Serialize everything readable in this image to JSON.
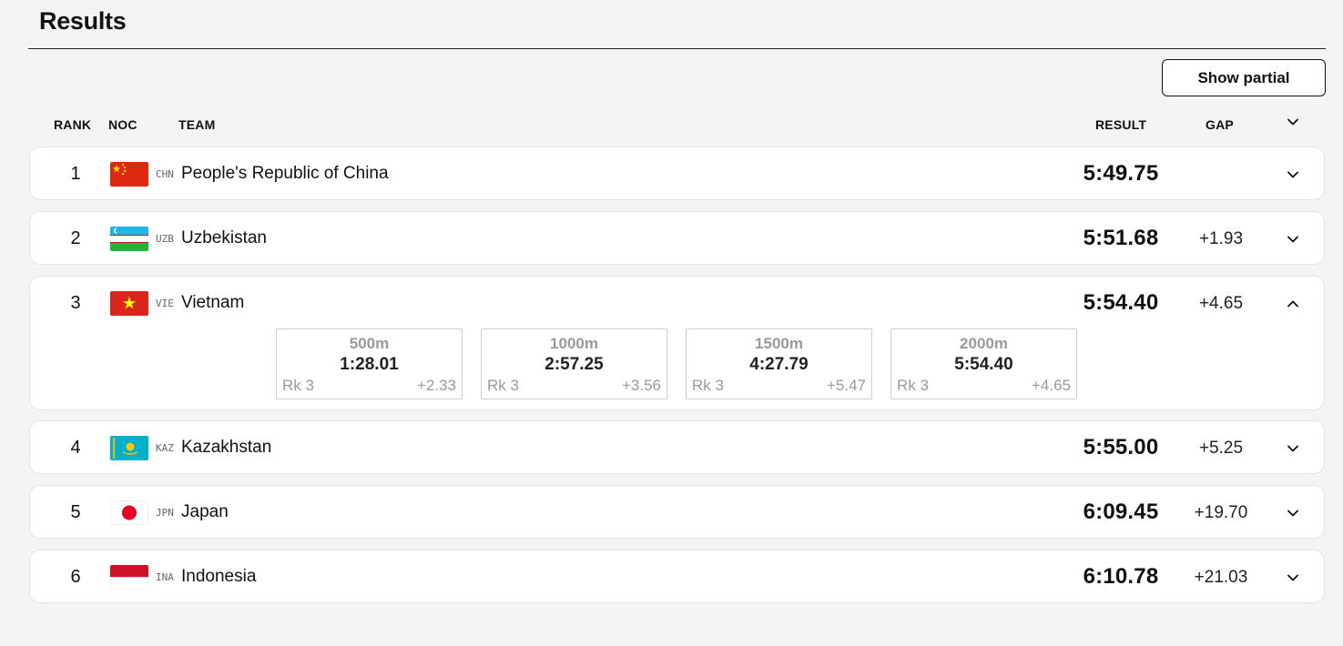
{
  "page": {
    "title": "Results"
  },
  "toolbar": {
    "show_partial_label": "Show partial"
  },
  "header": {
    "rank": "RANK",
    "noc": "NOC",
    "team": "TEAM",
    "result": "RESULT",
    "gap": "GAP"
  },
  "rows": [
    {
      "rank": "1",
      "noc": "CHN",
      "team": "People's Republic of China",
      "result": "5:49.75",
      "gap": "",
      "flag": "china-flag-icon"
    },
    {
      "rank": "2",
      "noc": "UZB",
      "team": "Uzbekistan",
      "result": "5:51.68",
      "gap": "+1.93",
      "flag": "uzbekistan-flag-icon"
    },
    {
      "rank": "3",
      "noc": "VIE",
      "team": "Vietnam",
      "result": "5:54.40",
      "gap": "+4.65",
      "flag": "vietnam-flag-icon",
      "expanded": true,
      "splits": [
        {
          "distance": "500m",
          "time": "1:28.01",
          "rank": "Rk 3",
          "gap": "+2.33"
        },
        {
          "distance": "1000m",
          "time": "2:57.25",
          "rank": "Rk 3",
          "gap": "+3.56"
        },
        {
          "distance": "1500m",
          "time": "4:27.79",
          "rank": "Rk 3",
          "gap": "+5.47"
        },
        {
          "distance": "2000m",
          "time": "5:54.40",
          "rank": "Rk 3",
          "gap": "+4.65"
        }
      ]
    },
    {
      "rank": "4",
      "noc": "KAZ",
      "team": "Kazakhstan",
      "result": "5:55.00",
      "gap": "+5.25",
      "flag": "kazakhstan-flag-icon"
    },
    {
      "rank": "5",
      "noc": "JPN",
      "team": "Japan",
      "result": "6:09.45",
      "gap": "+19.70",
      "flag": "japan-flag-icon"
    },
    {
      "rank": "6",
      "noc": "INA",
      "team": "Indonesia",
      "result": "6:10.78",
      "gap": "+21.03",
      "flag": "indonesia-flag-icon"
    }
  ],
  "colors": {
    "background": "#f4f4f4",
    "card": "#ffffff",
    "text": "#111111",
    "muted": "#9a9a9a"
  },
  "icons": {
    "expand": "chevron-down-icon",
    "collapse": "chevron-up-icon"
  }
}
